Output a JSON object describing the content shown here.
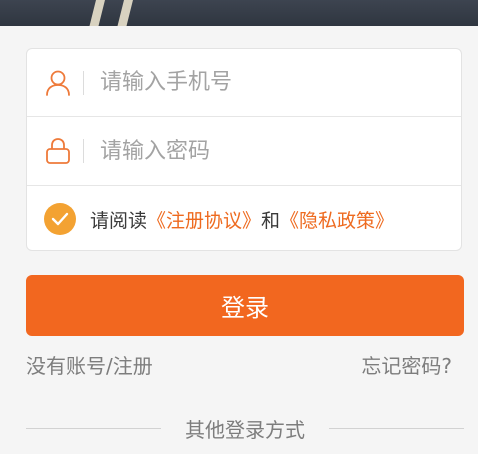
{
  "form": {
    "phone_placeholder": "请输入手机号",
    "password_placeholder": "请输入密码",
    "agree_checked": true,
    "agree_prefix": "请阅读",
    "agreement_link": "《注册协议》",
    "agree_and": "和",
    "privacy_link": "《隐私政策》"
  },
  "actions": {
    "login_label": "登录",
    "register_label": "没有账号/注册",
    "forgot_label": "忘记密码?"
  },
  "other_login": {
    "label": "其他登录方式"
  },
  "icons": {
    "phone_field": "user-icon",
    "password_field": "lock-icon",
    "agree": "check-icon"
  },
  "colors": {
    "accent": "#f2671f",
    "checkbox": "#f3a232",
    "link": "#ee6a1f",
    "muted_text": "#7d7d7d"
  }
}
